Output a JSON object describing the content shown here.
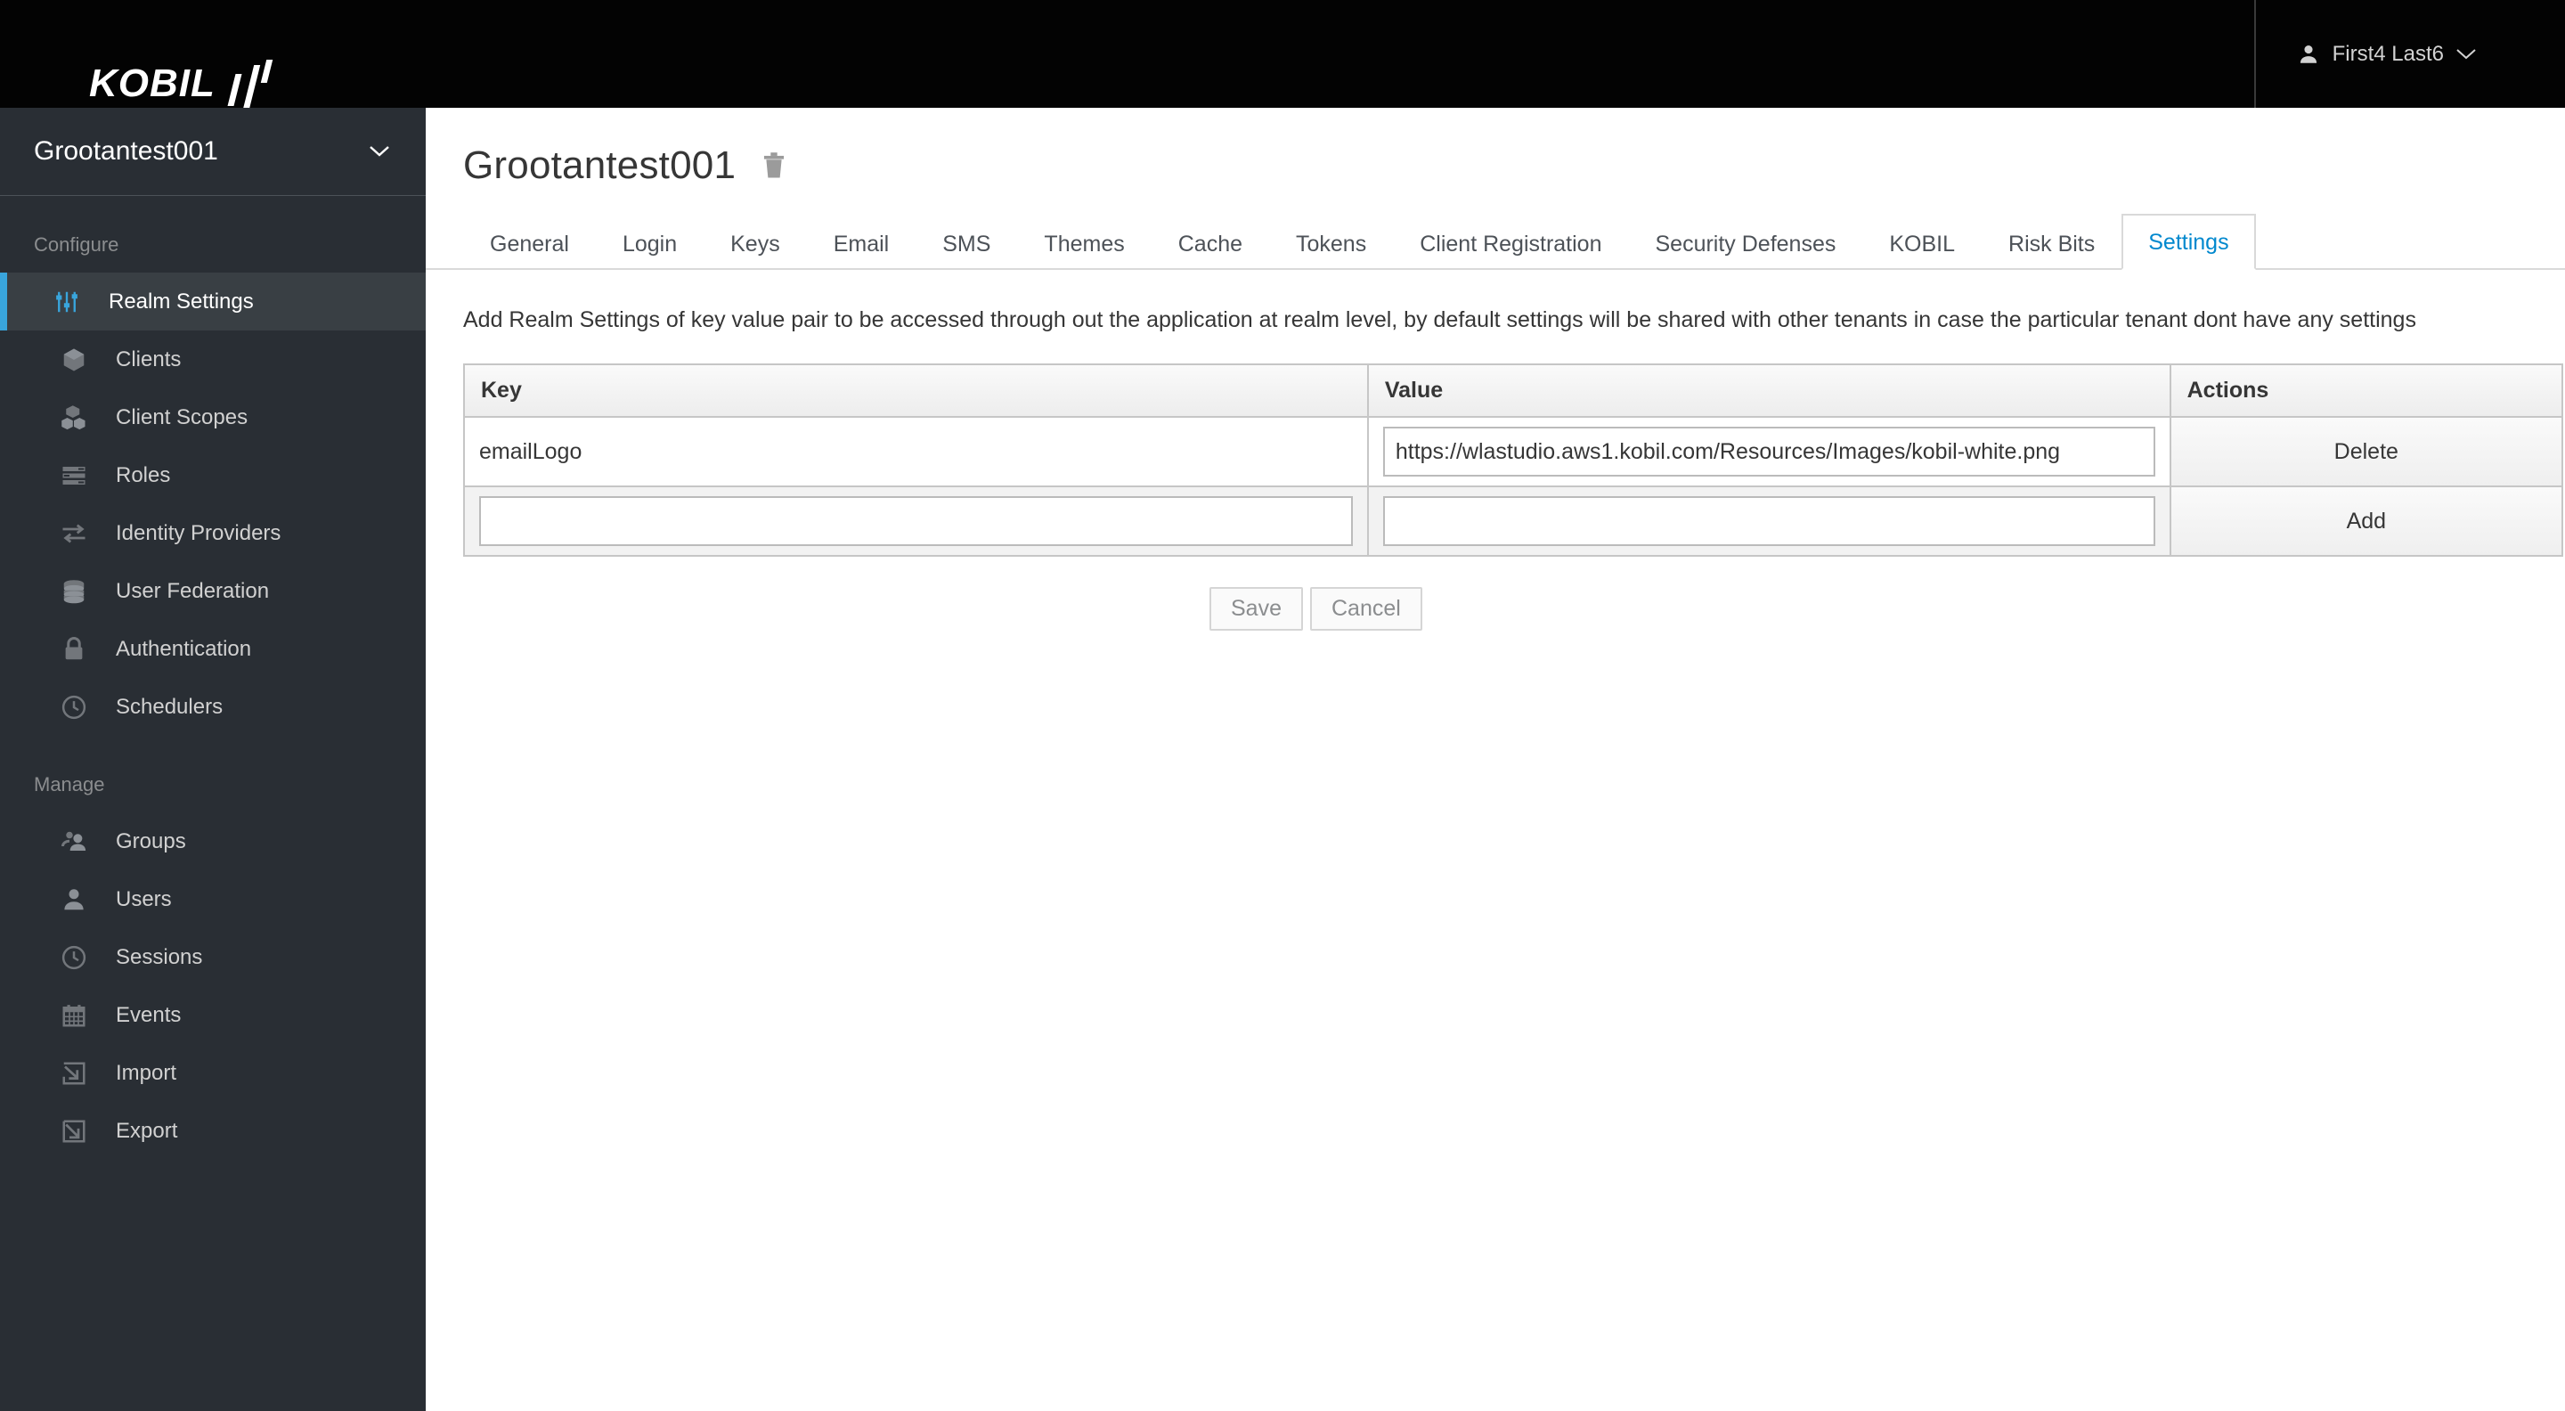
{
  "masthead": {
    "brand_text": "KOBIL",
    "brand_icon": "kobil-bars-logo",
    "user": {
      "name": "First4 Last6",
      "avatar_icon": "user-icon",
      "caret_icon": "chevron-down-icon"
    }
  },
  "sidebar": {
    "realm_selector": {
      "name": "Grootantest001",
      "caret_icon": "chevron-down-icon"
    },
    "sections": [
      {
        "label": "Configure",
        "items": [
          {
            "label": "Realm Settings",
            "icon": "sliders-icon",
            "active": true
          },
          {
            "label": "Clients",
            "icon": "cube-icon",
            "active": false
          },
          {
            "label": "Client Scopes",
            "icon": "cubes-icon",
            "active": false
          },
          {
            "label": "Roles",
            "icon": "list-rows-icon",
            "active": false
          },
          {
            "label": "Identity Providers",
            "icon": "exchange-arrows-icon",
            "active": false
          },
          {
            "label": "User Federation",
            "icon": "database-icon",
            "active": false
          },
          {
            "label": "Authentication",
            "icon": "lock-icon",
            "active": false
          },
          {
            "label": "Schedulers",
            "icon": "clock-icon",
            "active": false
          }
        ]
      },
      {
        "label": "Manage",
        "items": [
          {
            "label": "Groups",
            "icon": "users-group-icon",
            "active": false
          },
          {
            "label": "Users",
            "icon": "user-icon",
            "active": false
          },
          {
            "label": "Sessions",
            "icon": "clock-icon",
            "active": false
          },
          {
            "label": "Events",
            "icon": "calendar-icon",
            "active": false
          },
          {
            "label": "Import",
            "icon": "import-arrow-icon",
            "active": false
          },
          {
            "label": "Export",
            "icon": "export-arrow-icon",
            "active": false
          }
        ]
      }
    ]
  },
  "page": {
    "title": "Grootantest001",
    "delete_icon": "trash-icon",
    "tabs": [
      {
        "label": "General",
        "active": false
      },
      {
        "label": "Login",
        "active": false
      },
      {
        "label": "Keys",
        "active": false
      },
      {
        "label": "Email",
        "active": false
      },
      {
        "label": "SMS",
        "active": false
      },
      {
        "label": "Themes",
        "active": false
      },
      {
        "label": "Cache",
        "active": false
      },
      {
        "label": "Tokens",
        "active": false
      },
      {
        "label": "Client Registration",
        "active": false
      },
      {
        "label": "Security Defenses",
        "active": false
      },
      {
        "label": "KOBIL",
        "active": false
      },
      {
        "label": "Risk Bits",
        "active": false
      },
      {
        "label": "Settings",
        "active": true
      }
    ],
    "description": "Add Realm Settings of key value pair to be accessed through out the application at realm level, by default settings will be shared with other tenants in case the particular tenant dont have any settings",
    "table": {
      "columns": [
        "Key",
        "Value",
        "Actions"
      ],
      "rows": [
        {
          "key": "emailLogo",
          "key_is_input": false,
          "key_placeholder": "",
          "value": "https://wlastudio.aws1.kobil.com/Resources/Images/kobil-white.png",
          "value_placeholder": "",
          "action": "Delete"
        },
        {
          "key": "",
          "key_is_input": true,
          "key_placeholder": "",
          "value": "",
          "value_placeholder": "",
          "action": "Add"
        }
      ]
    },
    "buttons": {
      "save": "Save",
      "cancel": "Cancel"
    }
  },
  "colors": {
    "masthead_bg": "#030303",
    "sidebar_bg": "#292e34",
    "active_accent": "#39a5dc",
    "active_tab_text": "#0088ce",
    "body_text": "#363636"
  }
}
